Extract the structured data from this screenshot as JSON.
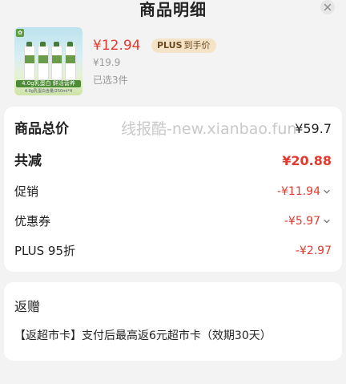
{
  "header": {
    "title": "商品明细"
  },
  "product": {
    "image": {
      "banner_text": "4.0g乳蛋白 鲜活营养",
      "sub_text": "4.0g乳蛋白含量/250ml*4"
    },
    "price": "¥12.94",
    "plus_badge": {
      "plus": "PLUS",
      "text": "到手价"
    },
    "original_price": "¥19.9",
    "selected_count": "已选3件"
  },
  "breakdown": {
    "total": {
      "label": "商品总价",
      "value": "¥59.7"
    },
    "reduction": {
      "label": "共减",
      "value": "¥20.88"
    },
    "promotion": {
      "label": "促销",
      "value": "-¥11.94"
    },
    "coupon": {
      "label": "优惠券",
      "value": "-¥5.97"
    },
    "plus_discount": {
      "label": "PLUS 95折",
      "value": "-¥2.97"
    }
  },
  "watermark": "线报酷-new.xianbao.fun",
  "gift": {
    "title": "返赠",
    "text": "【返超市卡】支付后最高返6元超市卡（效期30天）"
  },
  "colors": {
    "accent_red": "#e23a2e",
    "plus_badge_bg": "#f5e3c7",
    "page_bg": "#f3f3f3"
  },
  "icons": {
    "close": "close-icon",
    "chevron": "chevron-down-icon"
  }
}
